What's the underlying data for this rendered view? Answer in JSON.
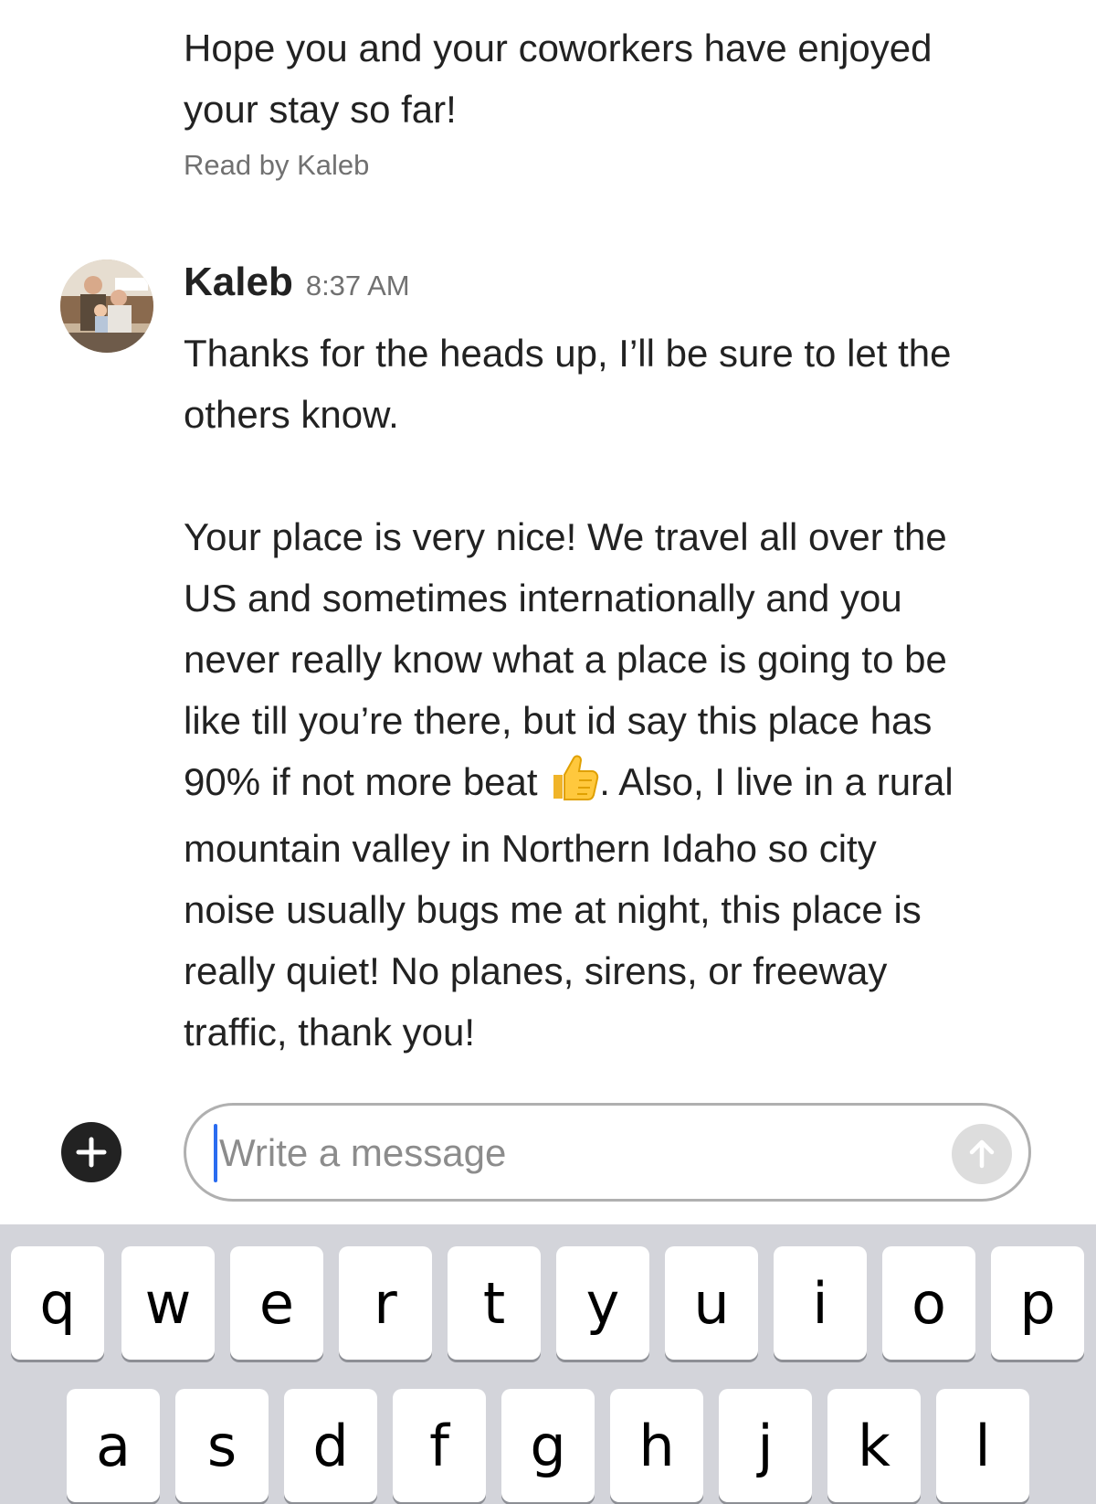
{
  "thread": {
    "previous_message_text": "Hope you and your coworkers have enjoyed\nyour stay so far!",
    "read_receipt": "Read by Kaleb",
    "message": {
      "sender": "Kaleb",
      "time": "8:37 AM",
      "paragraph_1": "Thanks for the heads up, I’ll be sure to let the\nothers know.",
      "paragraph_2_part_1": "Your place is very nice! We travel all over the\nUS and sometimes internationally and you\nnever really know what a place is going to be\nlike till you’re there, but id say this place has\n90% if not more beat ",
      "paragraph_2_part_2": ". Also, I live in a rural\nmountain valley in Northern Idaho so city\nnoise usually bugs me at night, this place is\nreally quiet! No planes, sirens, or freeway\ntraffic, thank you!",
      "emoji": "thumbs-up-icon"
    }
  },
  "composer": {
    "placeholder": "Write a message",
    "add_icon": "plus-icon",
    "send_icon": "arrow-up-icon"
  },
  "keyboard": {
    "row_1": [
      "q",
      "w",
      "e",
      "r",
      "t",
      "y",
      "u",
      "i",
      "o",
      "p"
    ],
    "row_2": [
      "a",
      "s",
      "d",
      "f",
      "g",
      "h",
      "j",
      "k",
      "l"
    ]
  },
  "colors": {
    "text": "#222222",
    "muted": "#717171",
    "caret": "#2a6cf0",
    "keyboard_bg": "#d3d4da"
  }
}
